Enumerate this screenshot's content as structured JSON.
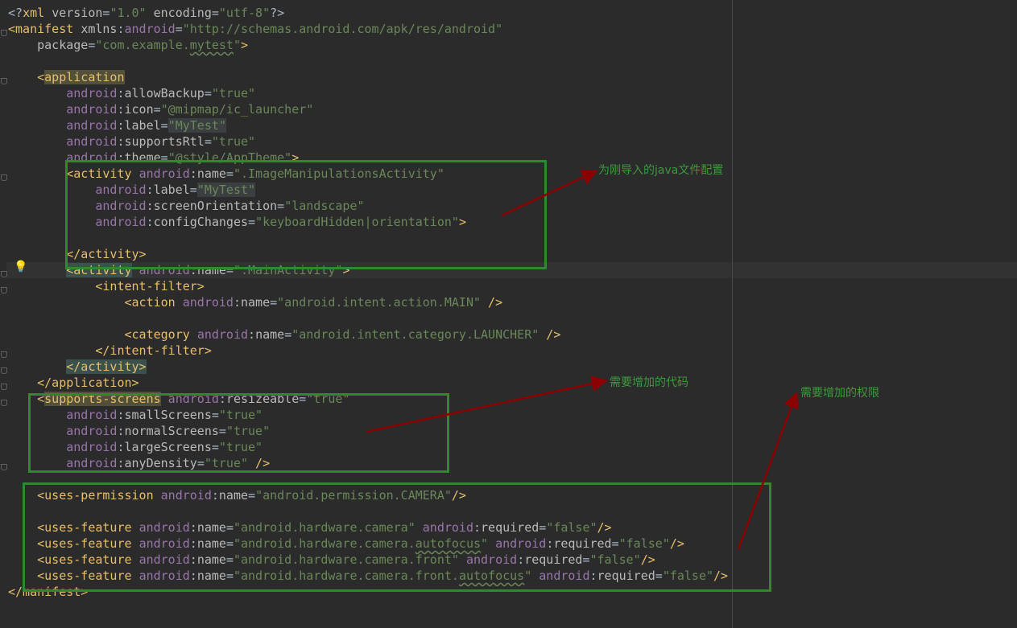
{
  "editor": {
    "lines": [
      [
        [
          "p",
          "<?"
        ],
        [
          "t",
          "xml "
        ],
        [
          "a",
          "version"
        ],
        [
          "p",
          "="
        ],
        [
          "s",
          "\"1.0\""
        ],
        [
          "a",
          " encoding"
        ],
        [
          "p",
          "="
        ],
        [
          "s",
          "\"utf-8\""
        ],
        [
          "p",
          "?>"
        ]
      ],
      [
        [
          "t",
          "<manifest "
        ],
        [
          "a",
          "xmlns"
        ],
        [
          "p",
          ":"
        ],
        [
          "n",
          "android"
        ],
        [
          "p",
          "="
        ],
        [
          "s",
          "\"http://schemas.android.com/apk/res/android\""
        ]
      ],
      [
        [
          "a",
          "    package"
        ],
        [
          "p",
          "="
        ],
        [
          "s",
          "\"com.example."
        ],
        [
          "s squig",
          "mytest"
        ],
        [
          "s",
          "\""
        ],
        [
          "t",
          ">"
        ]
      ],
      [],
      [
        [
          "p",
          "    "
        ],
        [
          "t",
          "<"
        ],
        [
          "t hl-app",
          "application"
        ]
      ],
      [
        [
          "n",
          "        android"
        ],
        [
          "p",
          ":"
        ],
        [
          "a",
          "allowBackup"
        ],
        [
          "p",
          "="
        ],
        [
          "s",
          "\"true\""
        ]
      ],
      [
        [
          "n",
          "        android"
        ],
        [
          "p",
          ":"
        ],
        [
          "a",
          "icon"
        ],
        [
          "p",
          "="
        ],
        [
          "s",
          "\"@mipmap/ic_launcher\""
        ]
      ],
      [
        [
          "n",
          "        android"
        ],
        [
          "p",
          ":"
        ],
        [
          "a",
          "label"
        ],
        [
          "p",
          "="
        ],
        [
          "s hl-str",
          "\"MyTest\""
        ]
      ],
      [
        [
          "n",
          "        android"
        ],
        [
          "p",
          ":"
        ],
        [
          "a",
          "supportsRtl"
        ],
        [
          "p",
          "="
        ],
        [
          "s",
          "\"true\""
        ]
      ],
      [
        [
          "n",
          "        android"
        ],
        [
          "p",
          ":"
        ],
        [
          "a",
          "theme"
        ],
        [
          "p",
          "="
        ],
        [
          "s",
          "\"@style/AppTheme\""
        ],
        [
          "t",
          ">"
        ]
      ],
      [
        [
          "t",
          "        <activity "
        ],
        [
          "n",
          "android"
        ],
        [
          "p",
          ":"
        ],
        [
          "a",
          "name"
        ],
        [
          "p",
          "="
        ],
        [
          "s",
          "\".ImageManipulationsActivity\""
        ]
      ],
      [
        [
          "n",
          "            android"
        ],
        [
          "p",
          ":"
        ],
        [
          "a",
          "label"
        ],
        [
          "p",
          "="
        ],
        [
          "s hl-str",
          "\"MyTest\""
        ]
      ],
      [
        [
          "n",
          "            android"
        ],
        [
          "p",
          ":"
        ],
        [
          "a",
          "screenOrientation"
        ],
        [
          "p",
          "="
        ],
        [
          "s",
          "\"landscape\""
        ]
      ],
      [
        [
          "n",
          "            android"
        ],
        [
          "p",
          ":"
        ],
        [
          "a",
          "configChanges"
        ],
        [
          "p",
          "="
        ],
        [
          "s",
          "\"keyboardHidden|orientation\""
        ],
        [
          "t",
          ">"
        ]
      ],
      [],
      [
        [
          "t",
          "        </activity>"
        ]
      ],
      [
        [
          "p",
          "        "
        ],
        [
          "t hl-act",
          "<activity"
        ],
        [
          "n",
          " android"
        ],
        [
          "p",
          ":"
        ],
        [
          "a",
          "name"
        ],
        [
          "p",
          "="
        ],
        [
          "s",
          "\".MainActivity\""
        ],
        [
          "t",
          ">"
        ]
      ],
      [
        [
          "t",
          "            <intent-filter>"
        ]
      ],
      [
        [
          "t",
          "                <action "
        ],
        [
          "n",
          "android"
        ],
        [
          "p",
          ":"
        ],
        [
          "a",
          "name"
        ],
        [
          "p",
          "="
        ],
        [
          "s",
          "\"android.intent.action.MAIN\""
        ],
        [
          "t",
          " />"
        ]
      ],
      [],
      [
        [
          "t",
          "                <category "
        ],
        [
          "n",
          "android"
        ],
        [
          "p",
          ":"
        ],
        [
          "a",
          "name"
        ],
        [
          "p",
          "="
        ],
        [
          "s",
          "\"android.intent.category.LAUNCHER\""
        ],
        [
          "t",
          " />"
        ]
      ],
      [
        [
          "t",
          "            </intent-filter>"
        ]
      ],
      [
        [
          "p",
          "        "
        ],
        [
          "t hl-act",
          "</activity>"
        ]
      ],
      [
        [
          "t",
          "    </application>"
        ]
      ],
      [
        [
          "t",
          "    <"
        ],
        [
          "t hl-app",
          "supports-screens"
        ],
        [
          "n",
          " android"
        ],
        [
          "p",
          ":"
        ],
        [
          "a",
          "resizeable"
        ],
        [
          "p",
          "="
        ],
        [
          "s",
          "\"true\""
        ]
      ],
      [
        [
          "n",
          "        android"
        ],
        [
          "p",
          ":"
        ],
        [
          "a",
          "smallScreens"
        ],
        [
          "p",
          "="
        ],
        [
          "s",
          "\"true\""
        ]
      ],
      [
        [
          "n",
          "        android"
        ],
        [
          "p",
          ":"
        ],
        [
          "a",
          "normalScreens"
        ],
        [
          "p",
          "="
        ],
        [
          "s",
          "\"true\""
        ]
      ],
      [
        [
          "n",
          "        android"
        ],
        [
          "p",
          ":"
        ],
        [
          "a",
          "largeScreens"
        ],
        [
          "p",
          "="
        ],
        [
          "s",
          "\"true\""
        ]
      ],
      [
        [
          "n",
          "        android"
        ],
        [
          "p",
          ":"
        ],
        [
          "a",
          "anyDensity"
        ],
        [
          "p",
          "="
        ],
        [
          "s",
          "\"true\""
        ],
        [
          "t",
          " />"
        ]
      ],
      [],
      [
        [
          "t",
          "    <uses-permission "
        ],
        [
          "n",
          "android"
        ],
        [
          "p",
          ":"
        ],
        [
          "a",
          "name"
        ],
        [
          "p",
          "="
        ],
        [
          "s",
          "\"android.permission.CAMERA\""
        ],
        [
          "t",
          "/>"
        ]
      ],
      [],
      [
        [
          "t",
          "    <uses-feature "
        ],
        [
          "n",
          "android"
        ],
        [
          "p",
          ":"
        ],
        [
          "a",
          "name"
        ],
        [
          "p",
          "="
        ],
        [
          "s",
          "\"android.hardware.camera\""
        ],
        [
          "n",
          " android"
        ],
        [
          "p",
          ":"
        ],
        [
          "a",
          "required"
        ],
        [
          "p",
          "="
        ],
        [
          "s",
          "\"false\""
        ],
        [
          "t",
          "/>"
        ]
      ],
      [
        [
          "t",
          "    <uses-feature "
        ],
        [
          "n",
          "android"
        ],
        [
          "p",
          ":"
        ],
        [
          "a",
          "name"
        ],
        [
          "p",
          "="
        ],
        [
          "s",
          "\"android.hardware.camera."
        ],
        [
          "s squig",
          "autofocus"
        ],
        [
          "s",
          "\""
        ],
        [
          "n",
          " android"
        ],
        [
          "p",
          ":"
        ],
        [
          "a",
          "required"
        ],
        [
          "p",
          "="
        ],
        [
          "s",
          "\"false\""
        ],
        [
          "t",
          "/>"
        ]
      ],
      [
        [
          "t",
          "    <uses-feature "
        ],
        [
          "n",
          "android"
        ],
        [
          "p",
          ":"
        ],
        [
          "a",
          "name"
        ],
        [
          "p",
          "="
        ],
        [
          "s",
          "\"android.hardware.camera.front\""
        ],
        [
          "n",
          " android"
        ],
        [
          "p",
          ":"
        ],
        [
          "a",
          "required"
        ],
        [
          "p",
          "="
        ],
        [
          "s",
          "\"false\""
        ],
        [
          "t",
          "/>"
        ]
      ],
      [
        [
          "t",
          "    <uses-feature "
        ],
        [
          "n",
          "android"
        ],
        [
          "p",
          ":"
        ],
        [
          "a",
          "name"
        ],
        [
          "p",
          "="
        ],
        [
          "s",
          "\"android.hardware.camera.front."
        ],
        [
          "s squig",
          "autofocus"
        ],
        [
          "s",
          "\""
        ],
        [
          "n",
          " android"
        ],
        [
          "p",
          ":"
        ],
        [
          "a",
          "required"
        ],
        [
          "p",
          "="
        ],
        [
          "s",
          "\"false\""
        ],
        [
          "t",
          "/>"
        ]
      ],
      [
        [
          "t",
          "</manifest>"
        ]
      ]
    ]
  },
  "annotations": {
    "activity_note": "为刚导入的java文件配置",
    "code_note": "需要增加的代码",
    "permission_note": "需要增加的权限"
  },
  "colors": {
    "background": "#2b2b2b",
    "tag": "#e8bf6a",
    "namespace": "#9876aa",
    "attribute": "#bababa",
    "string": "#6a8759",
    "annotation_box": "#2f8a2f",
    "annotation_text": "#3c9a3c",
    "arrow": "#8b0000"
  }
}
